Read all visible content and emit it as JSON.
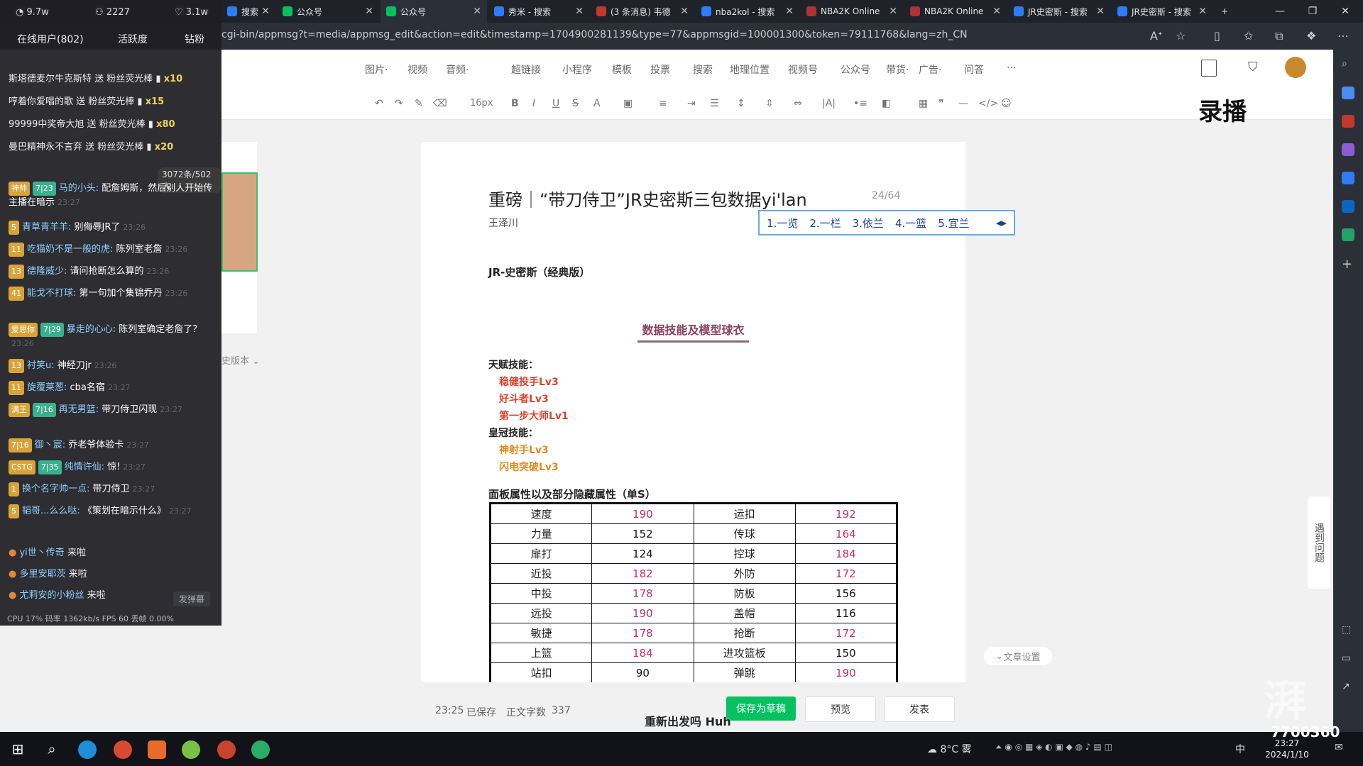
{
  "browser": {
    "tabs": [
      {
        "label": "9.7w",
        "color": "#6b6b6b"
      },
      {
        "label": "2227",
        "color": "#6b6b6b"
      },
      {
        "label": "3.1w",
        "color": "#6b6b6b"
      },
      {
        "label": "搜索",
        "color": "#2f7cf6"
      },
      {
        "label": "公众号",
        "color": "#07c160"
      },
      {
        "label": "公众号",
        "color": "#07c160"
      },
      {
        "label": "秀米 - 搜索",
        "color": "#2f7cf6"
      },
      {
        "label": "(3 条消息) 韦德",
        "color": "#c0392b"
      },
      {
        "label": "nba2kol - 搜索",
        "color": "#2f7cf6"
      },
      {
        "label": "NBA2K Online",
        "color": "#a33"
      },
      {
        "label": "NBA2K Online",
        "color": "#a33"
      },
      {
        "label": "JR史密斯 - 搜索",
        "color": "#2f7cf6"
      },
      {
        "label": "JR史密斯 - 搜索",
        "color": "#2f7cf6"
      }
    ],
    "url": "cgi-bin/appmsg?t=media/appmsg_edit&action=edit&timestamp=1704900281139&type=77&appmsgid=100001300&token=79111768&lang=zh_CN"
  },
  "editor": {
    "toolbar_main": [
      "图片·",
      "视频",
      "音频·",
      "超链接",
      "小程序",
      "模板",
      "投票",
      "搜索",
      "地理位置",
      "视频号",
      "公众号",
      "带货·",
      "广告·",
      "问答",
      "···"
    ],
    "font_size": "16px",
    "history_label": "史版本",
    "title_text": "重磅｜“带刀侍卫”JR史密斯三包数据yi'lan",
    "title_counter": "24/64",
    "author": "王泽川",
    "ime_candidates": [
      "1.一览",
      "2.一栏",
      "3.依兰",
      "4.一篮",
      "5.宜兰"
    ],
    "subtitle": "JR-史密斯（经典版）",
    "section_title": "数据技能及模型球衣",
    "talent_label": "天赋技能：",
    "talent_skills": [
      "稳健投手Lv3",
      "好斗者Lv3",
      "第一步大师Lv1"
    ],
    "crown_label": "皇冠技能：",
    "crown_skills": [
      "神射手Lv3",
      "闪电突破Lv3"
    ],
    "table_title": "面板属性以及部分隐藏属性（单S）",
    "attributes": [
      {
        "a": "速度",
        "av": "190",
        "ah": true,
        "b": "运扣",
        "bv": "192",
        "bh": true
      },
      {
        "a": "力量",
        "av": "152",
        "ah": false,
        "b": "传球",
        "bv": "164",
        "bh": true
      },
      {
        "a": "扉打",
        "av": "124",
        "ah": false,
        "b": "控球",
        "bv": "184",
        "bh": true
      },
      {
        "a": "近投",
        "av": "182",
        "ah": true,
        "b": "外防",
        "bv": "172",
        "bh": true
      },
      {
        "a": "中投",
        "av": "178",
        "ah": true,
        "b": "防板",
        "bv": "156",
        "bh": false
      },
      {
        "a": "远投",
        "av": "190",
        "ah": true,
        "b": "盖帽",
        "bv": "116",
        "bh": false
      },
      {
        "a": "敏捷",
        "av": "178",
        "ah": true,
        "b": "抢断",
        "bv": "172",
        "bh": true
      },
      {
        "a": "上篮",
        "av": "184",
        "ah": true,
        "b": "进攻篮板",
        "bv": "150",
        "bh": false
      },
      {
        "a": "站扣",
        "av": "90",
        "ah": false,
        "b": "弹跳",
        "bv": "190",
        "bh": true
      }
    ],
    "status_time": "23:25",
    "status_saved": "已保存",
    "word_count_label": "正文字数",
    "word_count": "337",
    "btn_save_draft": "保存为草稿",
    "btn_preview": "预览",
    "btn_publish": "发表",
    "help_label": "遇到问题",
    "article_settings": "文章设置",
    "accent": "#07c160"
  },
  "overlay": {
    "recording": "录播",
    "caption": "重新出发吗 Huh",
    "watermark": "湃",
    "watermark_num": "7700360"
  },
  "live": {
    "top_stats": [
      "9.7w",
      "2227",
      "3.1w"
    ],
    "tabs": [
      "在线用户(802)",
      "活跃度",
      "钻粉"
    ],
    "gifts": [
      {
        "text": "斯塔德麦尔牛克斯特 送 粉丝荧光棒",
        "count": "x10"
      },
      {
        "text": "哼着你爱唱的歌 送 粉丝荧光棒",
        "count": "x15"
      },
      {
        "text": "99999中奖帝大旭 送 粉丝荧光棒",
        "count": "x80"
      },
      {
        "text": "曼巴精神永不言弃 送 粉丝荧光棒",
        "count": "x20"
      }
    ],
    "viewer_pill": "3072条/502人",
    "chats": [
      {
        "badges": [
          "神帅",
          "7|23"
        ],
        "user": "马的小头:",
        "msg": "配詹姆斯，然后别人开始传主播在暗示",
        "time": "23:27"
      },
      {
        "badges": [
          "5"
        ],
        "user": "青草青羊羊:",
        "msg": "别侮辱JR了",
        "time": "23:26"
      },
      {
        "badges": [
          "11"
        ],
        "user": "吃猫奶不是一般的虎:",
        "msg": "陈列室老詹",
        "time": "23:26"
      },
      {
        "badges": [
          "13"
        ],
        "user": "德隆威少:",
        "msg": "请问抢断怎么算的",
        "time": "23:26"
      },
      {
        "badges": [
          "41"
        ],
        "user": "能戈不打球:",
        "msg": "第一句加个集锦乔丹",
        "time": "23:26"
      },
      {
        "badges": [
          "爱思你",
          "7|29"
        ],
        "user": "暴走的心心:",
        "msg": "陈列室确定老詹了？",
        "time": "23:26"
      },
      {
        "badges": [
          "13"
        ],
        "user": "衬笑u:",
        "msg": "神经刀jr",
        "time": "23:26"
      },
      {
        "badges": [
          "11"
        ],
        "user": "旋覆莱葱:",
        "msg": "cba名宿",
        "time": "23:27"
      },
      {
        "badges": [
          "满王",
          "7|16"
        ],
        "user": "再无男篮:",
        "msg": "带刀侍卫闪现",
        "time": "23:27"
      },
      {
        "badges": [
          "7|16"
        ],
        "user": "御丶宸:",
        "msg": "乔老爷体验卡",
        "time": "23:27"
      },
      {
        "badges": [
          "CSTG",
          "7|35"
        ],
        "user": "纯情许仙:",
        "msg": "惊!",
        "time": "23:27"
      },
      {
        "badges": [
          "1"
        ],
        "user": "换个名字帅一点:",
        "msg": "带刀侍卫",
        "time": "23:27"
      },
      {
        "badges": [
          "5"
        ],
        "user": "韬哥...么么哒:",
        "msg": "《策划在暗示什么》",
        "time": "23:27"
      }
    ],
    "joins": [
      {
        "user": "yi世丶传奇",
        "action": "来啦"
      },
      {
        "user": "多里安耶茨",
        "action": "来啦"
      },
      {
        "user": "尤莉安的小粉丝",
        "action": "来啦"
      }
    ],
    "danmu_button": "发弹幕",
    "stats": "CPU 17%     码率 1362kb/s  FPS 60      丢帧 0.00%"
  },
  "taskbar": {
    "weather": "8°C 雾",
    "ime": "中",
    "time": "23:27",
    "date": "2024/1/10"
  }
}
